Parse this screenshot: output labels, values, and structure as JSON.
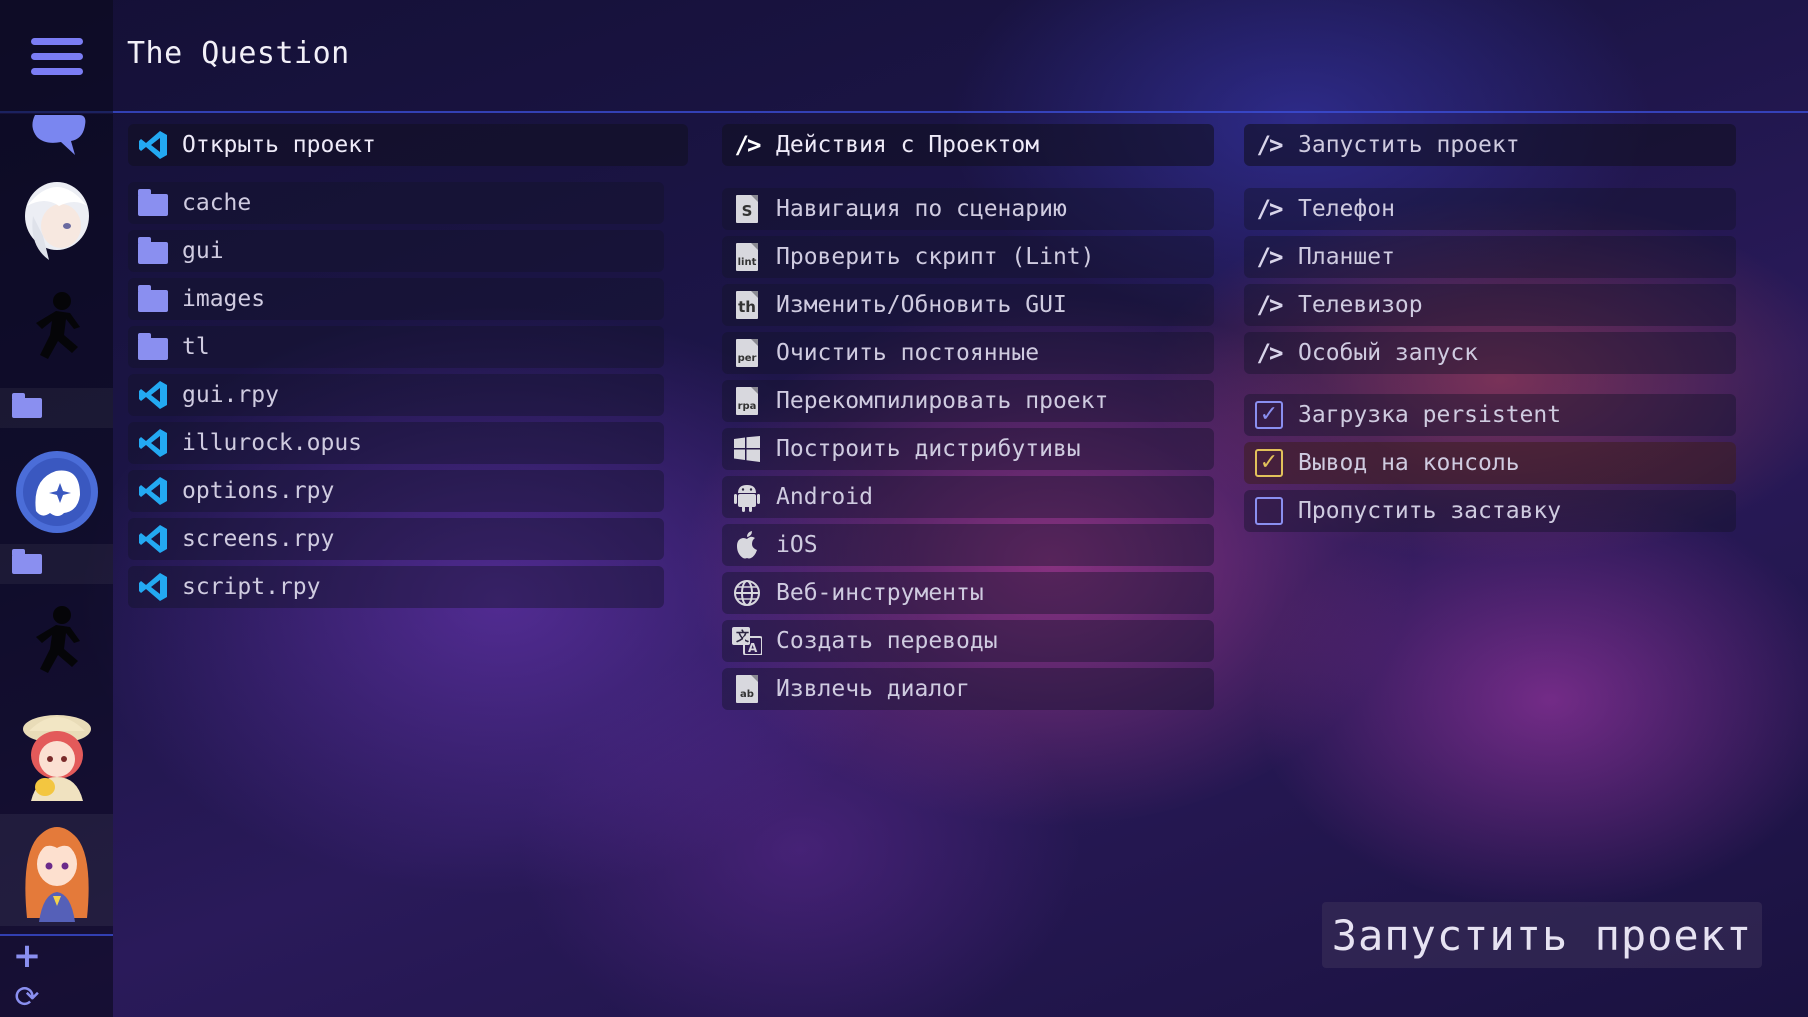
{
  "header": {
    "title": "The Question"
  },
  "sidebar": {
    "projects": [
      {
        "avatar": "speech-bubble-avatar"
      },
      {
        "avatar": "white-hair-character-avatar"
      },
      {
        "avatar": "running-silhouette-avatar"
      },
      {
        "avatar": "folder-icon"
      },
      {
        "avatar": "ghost-circle-avatar"
      },
      {
        "avatar": "folder-icon"
      },
      {
        "avatar": "running-silhouette-avatar"
      },
      {
        "avatar": "safari-girl-avatar"
      },
      {
        "avatar": "orange-hair-girl-avatar"
      }
    ],
    "add_label": "+",
    "refresh_label": "⟳"
  },
  "files": {
    "open_label": "Открыть проект",
    "items": [
      {
        "type": "folder",
        "name": "cache"
      },
      {
        "type": "folder",
        "name": "gui"
      },
      {
        "type": "folder",
        "name": "images"
      },
      {
        "type": "folder",
        "name": "tl"
      },
      {
        "type": "vscode",
        "name": "gui.rpy"
      },
      {
        "type": "vscode",
        "name": "illurock.opus"
      },
      {
        "type": "vscode",
        "name": "options.rpy"
      },
      {
        "type": "vscode",
        "name": "screens.rpy"
      },
      {
        "type": "vscode",
        "name": "script.rpy"
      }
    ]
  },
  "actions": {
    "header": "Действия с Проектом",
    "items": [
      {
        "icon": "doc-s-icon",
        "glyph": "S",
        "label": "Навигация по сценарию"
      },
      {
        "icon": "doc-lint-icon",
        "glyph": "lint",
        "label": "Проверить скрипт (Lint)"
      },
      {
        "icon": "doc-gui-icon",
        "glyph": "th",
        "label": "Изменить/Обновить GUI"
      },
      {
        "icon": "doc-per-icon",
        "glyph": "per",
        "label": "Очистить постоянные"
      },
      {
        "icon": "doc-rpa-icon",
        "glyph": "rpa",
        "label": "Перекомпилировать проект"
      },
      {
        "icon": "windows-icon",
        "glyph": "",
        "label": "Построить дистрибутивы"
      },
      {
        "icon": "android-icon",
        "glyph": "",
        "label": "Android"
      },
      {
        "icon": "apple-icon",
        "glyph": "",
        "label": "iOS"
      },
      {
        "icon": "globe-icon",
        "glyph": "",
        "label": "Веб-инструменты"
      },
      {
        "icon": "translate-icon",
        "glyph": "",
        "label": "Создать переводы"
      },
      {
        "icon": "doc-dialog-icon",
        "glyph": "ab",
        "label": "Извлечь диалог"
      }
    ]
  },
  "launch": {
    "header": "Запустить проект",
    "targets": [
      "Телефон",
      "Планшет",
      "Телевизор",
      "Особый запуск"
    ],
    "tag": "/>",
    "options": [
      {
        "label": "Загрузка persistent",
        "checked": true
      },
      {
        "label": "Вывод на консоль",
        "checked": true
      },
      {
        "label": "Пропустить заставку",
        "checked": false
      }
    ],
    "big_button": "Запустить проект",
    "check_mark": "✓"
  },
  "colors": {
    "accent": "#8a8ff0",
    "header_border": "#3c50dc",
    "vscode_blue": "#23a9f2",
    "check_gold": "#e2c15a"
  }
}
